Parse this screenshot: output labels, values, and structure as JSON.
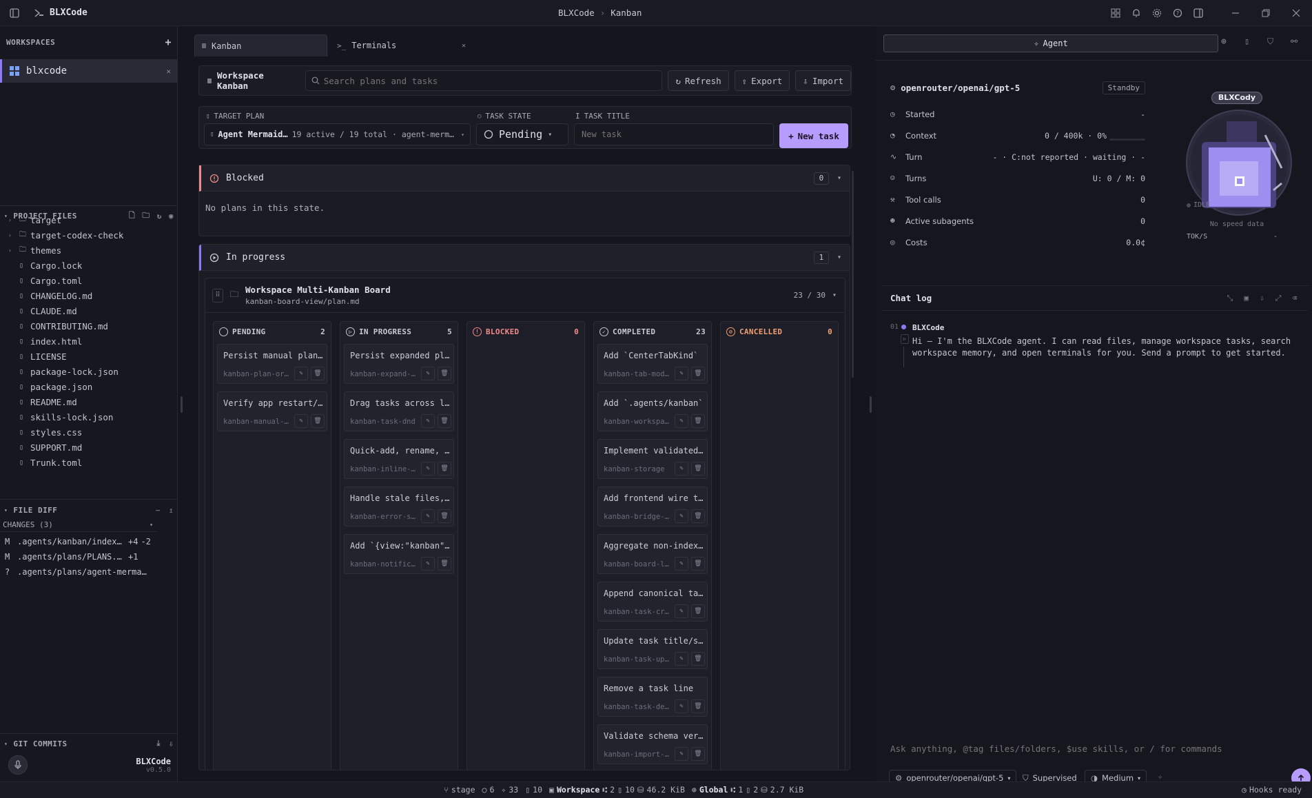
{
  "titlebar": {
    "app_name": "BLXCode",
    "breadcrumb_root": "BLXCode",
    "breadcrumb_current": "Kanban"
  },
  "sidebar": {
    "workspaces_label": "WORKSPACES",
    "workspace_name": "blxcode",
    "project_files_label": "PROJECT FILES",
    "files": [
      {
        "name": "target",
        "type": "folder"
      },
      {
        "name": "target-codex-check",
        "type": "folder"
      },
      {
        "name": "themes",
        "type": "folder"
      },
      {
        "name": "Cargo.lock",
        "type": "file"
      },
      {
        "name": "Cargo.toml",
        "type": "file"
      },
      {
        "name": "CHANGELOG.md",
        "type": "file"
      },
      {
        "name": "CLAUDE.md",
        "type": "file"
      },
      {
        "name": "CONTRIBUTING.md",
        "type": "file"
      },
      {
        "name": "index.html",
        "type": "file"
      },
      {
        "name": "LICENSE",
        "type": "file"
      },
      {
        "name": "package-lock.json",
        "type": "file"
      },
      {
        "name": "package.json",
        "type": "file"
      },
      {
        "name": "README.md",
        "type": "file"
      },
      {
        "name": "skills-lock.json",
        "type": "file"
      },
      {
        "name": "styles.css",
        "type": "file"
      },
      {
        "name": "SUPPORT.md",
        "type": "file"
      },
      {
        "name": "Trunk.toml",
        "type": "file"
      }
    ],
    "file_diff_label": "FILE DIFF",
    "changes_label": "CHANGES (3)",
    "changes": [
      {
        "status": "M",
        "path": ".agents/kanban/index.json",
        "adds": "+4",
        "dels": "-2"
      },
      {
        "status": "M",
        "path": ".agents/plans/PLANS.md",
        "adds": "+1",
        "dels": ""
      },
      {
        "status": "?",
        "path": ".agents/plans/agent-mermaid-diagrams.md",
        "adds": "",
        "dels": ""
      }
    ],
    "git_commits_label": "GIT COMMITS",
    "brand_name": "BLXCode",
    "brand_version": "v0.5.0"
  },
  "center": {
    "tabs": [
      {
        "label": "Kanban",
        "active": true
      },
      {
        "label": "Terminals",
        "active": false
      }
    ],
    "toolbar": {
      "title": "Workspace Kanban",
      "search_placeholder": "Search plans and tasks",
      "refresh_label": "Refresh",
      "export_label": "Export",
      "import_label": "Import"
    },
    "form": {
      "target_plan_label": "TARGET PLAN",
      "target_plan_name": "Agent Mermaid…",
      "target_plan_meta": "19 active / 19 total · agent-merm…",
      "task_state_label": "TASK STATE",
      "task_state_value": "Pending",
      "task_title_label": "TASK TITLE",
      "task_title_placeholder": "New task",
      "new_task_label": "New task"
    },
    "blocked": {
      "title": "Blocked",
      "count": "0",
      "empty_text": "No plans in this state."
    },
    "in_progress": {
      "title": "In progress",
      "count": "1"
    },
    "board": {
      "title": "Workspace Multi-Kanban Board",
      "path": "kanban-board-view/plan.md",
      "progress": "23 / 30",
      "columns": [
        {
          "title": "PENDING",
          "count": "2",
          "color": "#c9c9d4",
          "cards": [
            {
              "title": "Persist manual plan order",
              "slug": "kanban-plan-order"
            },
            {
              "title": "Verify app restart/reload",
              "slug": "kanban-manual-check"
            }
          ]
        },
        {
          "title": "IN PROGRESS",
          "count": "5",
          "color": "#c9c9d4",
          "cards": [
            {
              "title": "Persist expanded plans",
              "slug": "kanban-expand-state"
            },
            {
              "title": "Drag tasks across lanes",
              "slug": "kanban-task-dnd"
            },
            {
              "title": "Quick-add, rename, delete",
              "slug": "kanban-inline-edit"
            },
            {
              "title": "Handle stale files, errors",
              "slug": "kanban-error-states"
            },
            {
              "title": "Add `{view:\"kanban\"}`",
              "slug": "kanban-notification"
            }
          ]
        },
        {
          "title": "BLOCKED",
          "count": "0",
          "color": "#f08a8a",
          "cards": []
        },
        {
          "title": "COMPLETED",
          "count": "23",
          "color": "#c9c9d4",
          "cards": [
            {
              "title": "Add `CenterTabKind`",
              "slug": "kanban-tab-model"
            },
            {
              "title": "Add `.agents/kanban`",
              "slug": "kanban-workspace"
            },
            {
              "title": "Implement validated storage",
              "slug": "kanban-storage"
            },
            {
              "title": "Add frontend wire types",
              "slug": "kanban-bridge-types"
            },
            {
              "title": "Aggregate non-indexed",
              "slug": "kanban-board-load"
            },
            {
              "title": "Append canonical tasks",
              "slug": "kanban-task-create"
            },
            {
              "title": "Update task title/state",
              "slug": "kanban-task-update"
            },
            {
              "title": "Remove a task line",
              "slug": "kanban-task-delete"
            },
            {
              "title": "Validate schema version",
              "slug": "kanban-import-check"
            }
          ]
        },
        {
          "title": "CANCELLED",
          "count": "0",
          "color": "#f0a070",
          "cards": []
        }
      ]
    }
  },
  "right": {
    "agent_tab_label": "Agent",
    "model_name": "openrouter/openai/gpt-5",
    "standby_label": "Standby",
    "stats": [
      {
        "label": "Started",
        "value": "-",
        "icon": "clock-icon"
      },
      {
        "label": "Context",
        "value": "0 / 400k · 0%",
        "icon": "gauge-icon"
      },
      {
        "label": "Turn",
        "value": "- · C:not reported · waiting · -",
        "icon": "pulse-icon"
      },
      {
        "label": "Turns",
        "value": "U: 0 / M: 0",
        "icon": "user-icon"
      },
      {
        "label": "Tool calls",
        "value": "0",
        "icon": "wrench-icon"
      },
      {
        "label": "Active subagents",
        "value": "0",
        "icon": "users-icon"
      },
      {
        "label": "Costs",
        "value": "0.0¢",
        "icon": "coin-icon"
      }
    ],
    "avatar_name": "BLXCody",
    "idle_label": "IDLE",
    "no_speed_label": "No speed data",
    "toks_label": "TOK/S",
    "toks_value": "-",
    "chat_log_label": "Chat log",
    "message_index": "01",
    "message_author": "BLXCode",
    "message_text": "Hi — I'm the BLXCode agent. I can read files, manage workspace tasks, search workspace memory, and open terminals for you. Send a prompt to get started.",
    "input_placeholder": "Ask anything, @tag files/folders, $use skills, or / for commands",
    "model_select": "openrouter/openai/gpt-5",
    "mode_label": "Supervised",
    "effort_label": "Medium"
  },
  "statusbar": {
    "branch": "stage",
    "s1": "6",
    "s2": "33",
    "s3": "10",
    "workspace_label": "Workspace",
    "ws_n1": "2",
    "ws_n2": "10",
    "ws_size": "46.2 KiB",
    "global_label": "Global",
    "gl_n1": "1",
    "gl_n2": "2",
    "gl_size": "2.7 KiB",
    "hooks_label": "Hooks ready"
  },
  "colors": {
    "accent": "#b79cff",
    "blocked": "#f08a8a",
    "cancelled": "#f0a070",
    "bg": "#15151d"
  }
}
